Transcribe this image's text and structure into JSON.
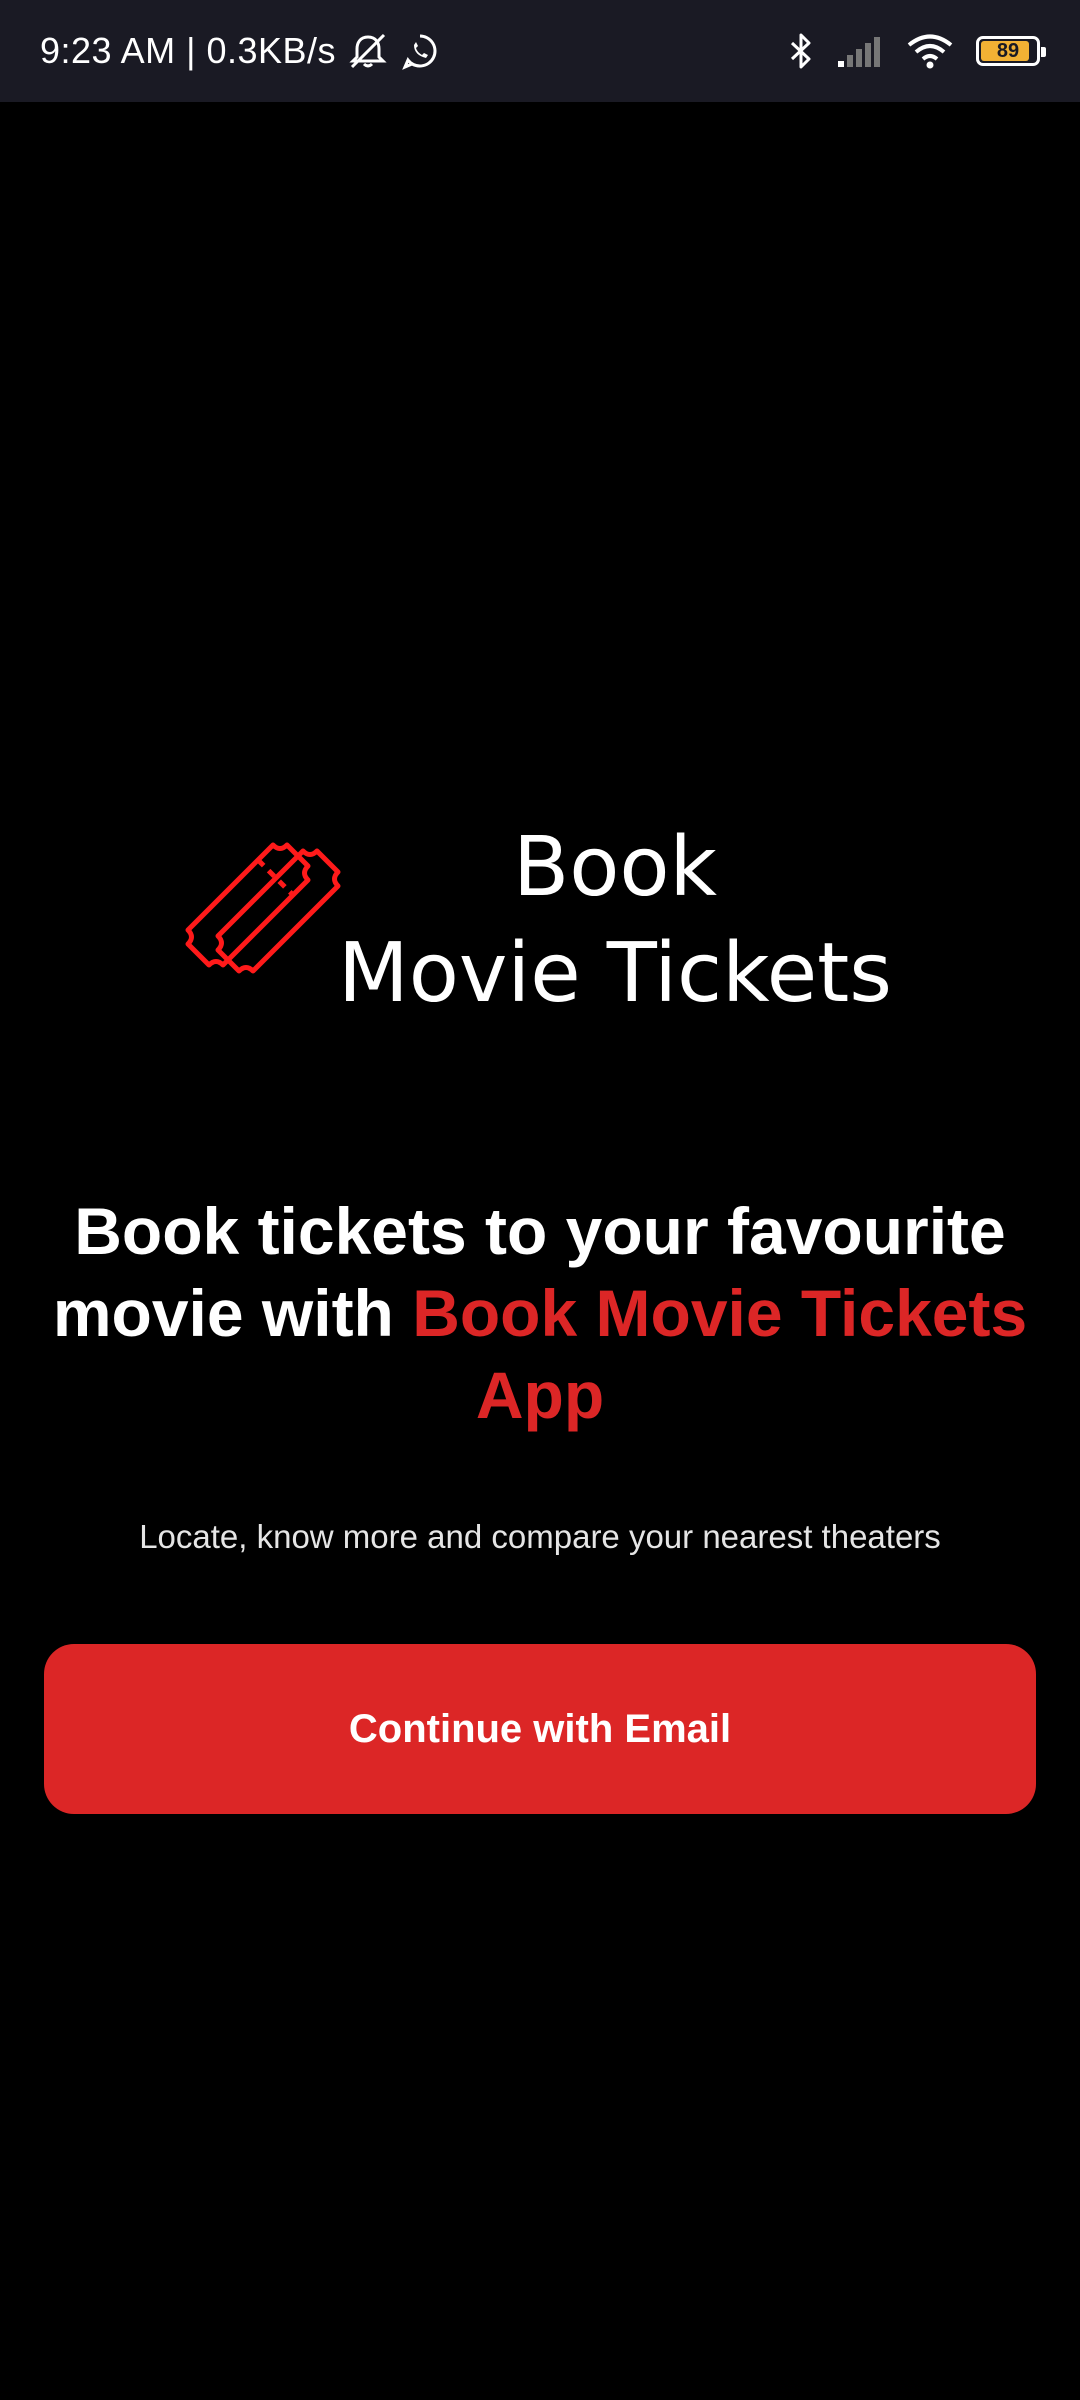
{
  "status_bar": {
    "time_and_speed": "9:23 AM | 0.3KB/s",
    "battery_level": "89",
    "battery_fraction": 0.89,
    "icons": [
      "muted-notification-icon",
      "whatsapp-icon",
      "bluetooth-icon",
      "signal-icon",
      "wifi-icon",
      "battery-icon"
    ]
  },
  "logo": {
    "line1": "Book",
    "line2": "Movie Tickets",
    "icon": "ticket-icon"
  },
  "headline": {
    "part1": "Book tickets to your favourite movie with ",
    "accent": "Book Movie Tickets App"
  },
  "subtitle": "Locate, know more and compare your nearest theaters",
  "cta": {
    "label": "Continue with Email"
  },
  "colors": {
    "background": "#000000",
    "accent": "#dc2626",
    "status_bar": "#1a1a24",
    "battery": "#f2b134"
  }
}
